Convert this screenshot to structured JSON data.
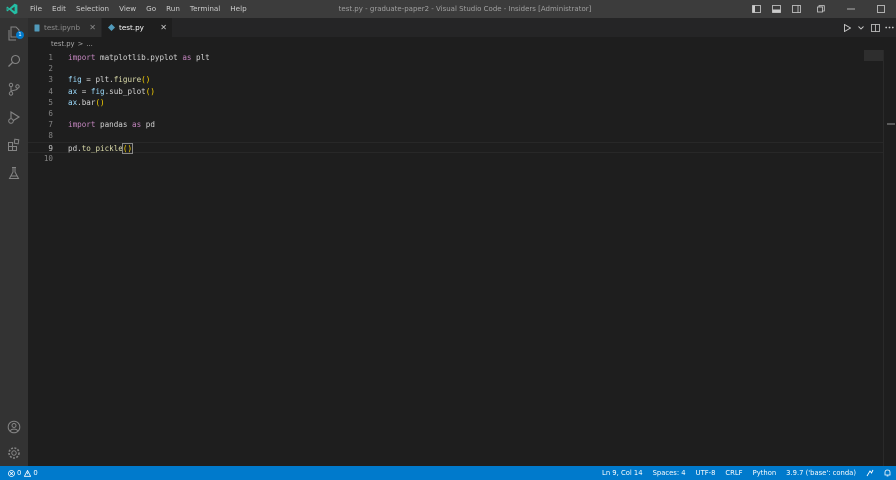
{
  "titlebar": {
    "menu": [
      "File",
      "Edit",
      "Selection",
      "View",
      "Go",
      "Run",
      "Terminal",
      "Help"
    ],
    "window_title": "test.py - graduate-paper2 - Visual Studio Code - Insiders [Administrator]"
  },
  "activitybar": {
    "items": [
      {
        "name": "explorer",
        "badge": "1"
      },
      {
        "name": "search"
      },
      {
        "name": "source-control"
      },
      {
        "name": "run-and-debug"
      },
      {
        "name": "extensions"
      },
      {
        "name": "testing"
      }
    ],
    "bottom": [
      {
        "name": "accounts"
      },
      {
        "name": "manage"
      }
    ]
  },
  "tabs": [
    {
      "label": "test.ipynb",
      "active": false,
      "icon": "notebook-icon"
    },
    {
      "label": "test.py",
      "active": true,
      "icon": "python-icon"
    }
  ],
  "tab_close_glyph": "✕",
  "breadcrumb": {
    "file": "test.py",
    "separator": ">",
    "more": "..."
  },
  "editor": {
    "current_line": 9,
    "lines": [
      {
        "n": "1",
        "tokens": [
          {
            "t": "import",
            "c": "kw"
          },
          {
            "t": " matplotlib.pyplot ",
            "c": "pl"
          },
          {
            "t": "as",
            "c": "kw"
          },
          {
            "t": " plt",
            "c": "pl"
          }
        ]
      },
      {
        "n": "2",
        "tokens": []
      },
      {
        "n": "3",
        "tokens": [
          {
            "t": "fig",
            "c": "var"
          },
          {
            "t": " = ",
            "c": "pl"
          },
          {
            "t": "plt",
            "c": "pl"
          },
          {
            "t": ".",
            "c": "pl"
          },
          {
            "t": "figure",
            "c": "fn"
          },
          {
            "t": "()",
            "c": "br1"
          }
        ]
      },
      {
        "n": "4",
        "tokens": [
          {
            "t": "ax",
            "c": "var"
          },
          {
            "t": " = ",
            "c": "pl"
          },
          {
            "t": "fig",
            "c": "var"
          },
          {
            "t": ".sub_plot",
            "c": "pl"
          },
          {
            "t": "()",
            "c": "br1"
          }
        ]
      },
      {
        "n": "5",
        "tokens": [
          {
            "t": "ax",
            "c": "var"
          },
          {
            "t": ".bar",
            "c": "pl"
          },
          {
            "t": "()",
            "c": "br1"
          }
        ]
      },
      {
        "n": "6",
        "tokens": []
      },
      {
        "n": "7",
        "tokens": [
          {
            "t": "import",
            "c": "kw"
          },
          {
            "t": " pandas ",
            "c": "pl"
          },
          {
            "t": "as",
            "c": "kw"
          },
          {
            "t": " pd",
            "c": "pl"
          }
        ]
      },
      {
        "n": "8",
        "tokens": []
      },
      {
        "n": "9",
        "tokens": [
          {
            "t": "pd",
            "c": "pl"
          },
          {
            "t": ".",
            "c": "pl"
          },
          {
            "t": "to_pickle",
            "c": "fn"
          },
          {
            "t": "()",
            "c": "br1 cursor-br"
          }
        ]
      },
      {
        "n": "10",
        "tokens": []
      }
    ]
  },
  "statusbar": {
    "left": {
      "errors": "0",
      "warnings": "0"
    },
    "right": [
      "Ln 9, Col 14",
      "Spaces: 4",
      "UTF-8",
      "CRLF",
      "Python",
      "3.9.7 ('base': conda)"
    ]
  },
  "colors": {
    "accent": "#007acc",
    "titlebar": "#3c3c3c",
    "activitybar": "#333333",
    "editor": "#1e1e1e",
    "keyword": "#c586c0",
    "function": "#dcdcaa",
    "variable": "#9cdcfe"
  }
}
